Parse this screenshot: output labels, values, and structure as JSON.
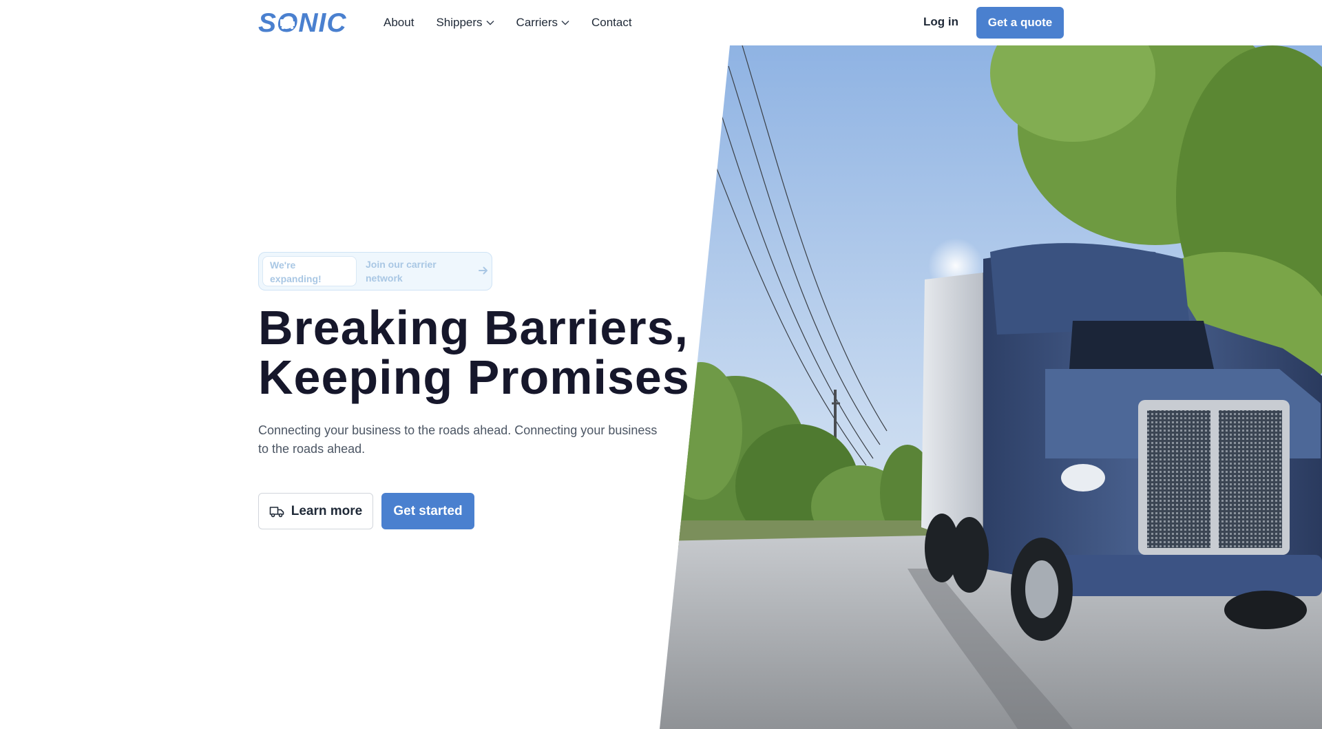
{
  "brand": {
    "logo_text": "SONIC",
    "logo_color": "#4a80cf"
  },
  "nav": {
    "items": [
      {
        "label": "About",
        "has_dropdown": false
      },
      {
        "label": "Shippers",
        "has_dropdown": true
      },
      {
        "label": "Carriers",
        "has_dropdown": true
      },
      {
        "label": "Contact",
        "has_dropdown": false
      }
    ],
    "login_label": "Log in",
    "quote_label": "Get a quote"
  },
  "hero": {
    "announcement": {
      "tag": "We're\nexpanding!",
      "text": "Join our carrier\nnetwork",
      "icon": "arrow-right-icon"
    },
    "headline": "Breaking Barriers,\nKeeping Promises",
    "subtext": "Connecting your business to the roads ahead. Connecting your business to the roads ahead.",
    "buttons": {
      "learn_more": {
        "label": "Learn more",
        "icon": "truck-icon"
      },
      "get_started": {
        "label": "Get started"
      }
    },
    "image": {
      "subject": "blue semi-truck on tree-lined road"
    }
  },
  "colors": {
    "accent": "#4a80cf",
    "heading": "#16172b",
    "body_text": "#4b5563",
    "pill_bg": "#eff7fd",
    "pill_text": "#a9c7e4"
  }
}
